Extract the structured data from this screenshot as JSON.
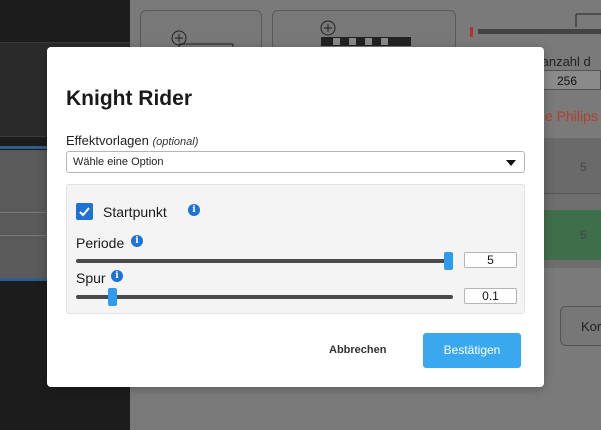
{
  "background": {
    "strip_label": "tanzahl d",
    "count_value": "256",
    "brand_text": "e Philips",
    "table_values": [
      "5",
      "5"
    ],
    "button_label": "Kor"
  },
  "modal": {
    "title": "Knight Rider",
    "preset": {
      "label": "Effektvorlagen",
      "optional_note": "(optional)",
      "selected": "Wähle eine Option"
    },
    "startpoint": {
      "label": "Startpunkt",
      "checked": true
    },
    "period": {
      "label": "Periode",
      "value": "5",
      "fraction": 1.0
    },
    "trail": {
      "label": "Spur",
      "value": "0.1",
      "fraction": 0.0
    },
    "info_glyph": "i",
    "cancel_label": "Abbrechen",
    "confirm_label": "Bestätigen"
  },
  "colors": {
    "accent": "#1e72d6",
    "confirm": "#3aa8ee",
    "slider_thumb": "#2d9cf0"
  }
}
